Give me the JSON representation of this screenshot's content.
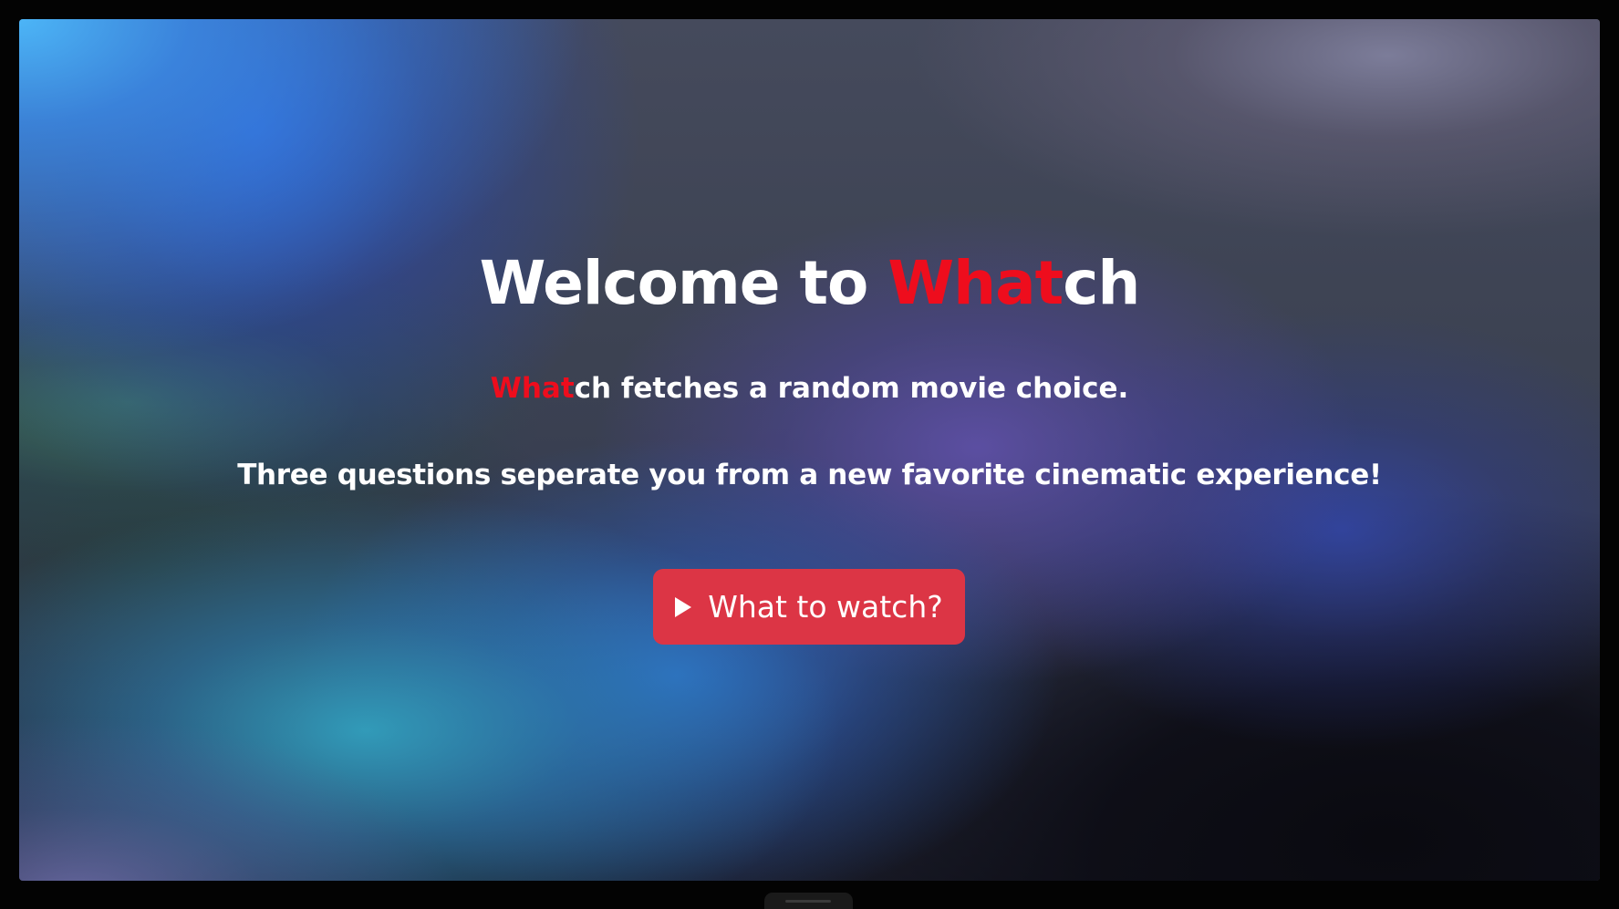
{
  "colors": {
    "accent_red": "#ee0d1d",
    "button_bg": "#dc3545",
    "text": "#ffffff",
    "bezel": "#030303"
  },
  "hero": {
    "title_prefix": "Welcome to ",
    "brand_highlight": "What",
    "brand_suffix": "ch",
    "tagline_highlight": "What",
    "tagline_rest": "ch fetches a random movie choice.",
    "subline": "Three questions seperate you from a new favorite cinematic experience!"
  },
  "cta": {
    "icon": "play-icon",
    "label": "What to watch?"
  }
}
